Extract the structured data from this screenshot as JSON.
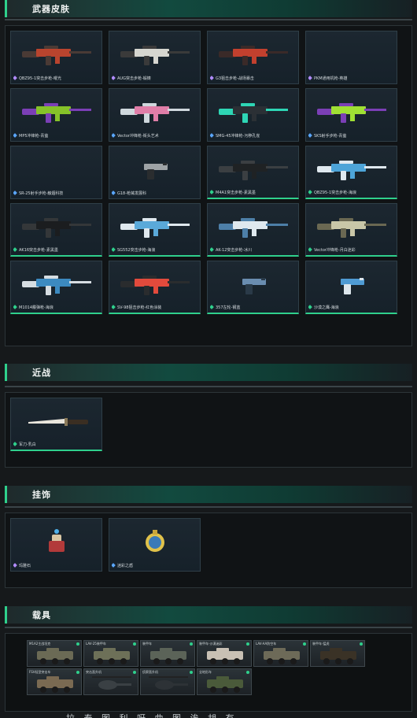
{
  "sections": {
    "weapons": {
      "title": "武器皮肤"
    },
    "melee": {
      "title": "近战"
    },
    "pendant": {
      "title": "挂饰"
    },
    "vehicles": {
      "title": "载具"
    }
  },
  "colors": {
    "accent": "#2fd08c",
    "purple_gem": "#b18cff",
    "blue_gem": "#5aa6ff",
    "green_gem": "#2fd08c"
  },
  "weapons": [
    {
      "label": "QBZ95-1突击步枪-曜光",
      "gem": "purple"
    },
    {
      "label": "AUG突击步枪-锻铸",
      "gem": "purple"
    },
    {
      "label": "G3狙击步枪-战场暴击",
      "gem": "purple"
    },
    {
      "label": "PKM通用机枪-英雄",
      "gem": "purple"
    },
    {
      "label": "MP5冲锋枪-青萤",
      "gem": "blue"
    },
    {
      "label": "Vector冲锋枪-街头艺术",
      "gem": "blue"
    },
    {
      "label": "SMG-45冲锋枪-污秽孔雀",
      "gem": "blue"
    },
    {
      "label": "SKS射手步枪-青萤",
      "gem": "blue"
    },
    {
      "label": "SR-25射手步枪-触烟科技",
      "gem": "blue"
    },
    {
      "label": "G18-枪械发展科",
      "gem": "blue"
    },
    {
      "label": "M4A1突击步枪-素黑墨",
      "gem": "green"
    },
    {
      "label": "QBZ95-1突击步枪-海浪",
      "gem": "green"
    },
    {
      "label": "AK16突击步枪-素黑墨",
      "gem": "green"
    },
    {
      "label": "SG552突击步枪-海浪",
      "gem": "green"
    },
    {
      "label": "AK-12突击步枪-冰川",
      "gem": "green"
    },
    {
      "label": "Vector冲锋枪-月白迷彩",
      "gem": "green"
    },
    {
      "label": "M1014霰弹枪-海浪",
      "gem": "green"
    },
    {
      "label": "SV-98狙击步枪-红色涂装",
      "gem": "green"
    },
    {
      "label": "357左轮-钢蓝",
      "gem": "green"
    },
    {
      "label": "沙漠之鹰-海浪",
      "gem": "green"
    }
  ],
  "melee": [
    {
      "label": "军刀-乳白",
      "gem": "green"
    }
  ],
  "pendants": [
    {
      "label": "玛雅石",
      "gem": "purple"
    },
    {
      "label": "迷彩之盾",
      "gem": "blue"
    }
  ],
  "vehicles": [
    {
      "label": "M1A2主战坦克"
    },
    {
      "label": "LAV-25装甲车"
    },
    {
      "label": "装甲车"
    },
    {
      "label": "装甲车-沙漠迷彩"
    },
    {
      "label": "LAV-AA防空车"
    },
    {
      "label": "装甲车-猛虎"
    },
    {
      "label": "FSV轻型突击车"
    },
    {
      "label": "突击直升机"
    },
    {
      "label": "侦察直升机"
    },
    {
      "label": "全地形车"
    }
  ],
  "bottom_text": "拉 泰 图 利 呀 曲 图 诶 胡 有"
}
